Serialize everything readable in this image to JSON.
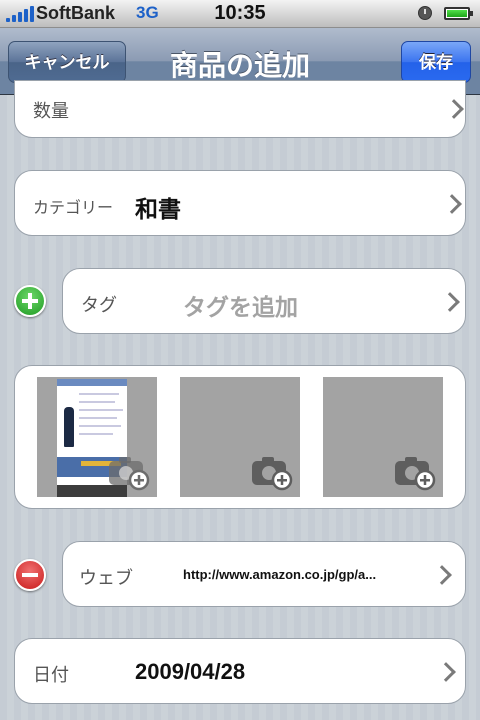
{
  "status_bar": {
    "carrier": "SoftBank",
    "network": "3G",
    "time": "10:35",
    "icons": [
      "signal-icon",
      "alarm-icon",
      "battery-icon"
    ]
  },
  "nav": {
    "title": "商品の追加",
    "cancel_label": "キャンセル",
    "save_label": "保存"
  },
  "form": {
    "quantity": {
      "label": "数量"
    },
    "category": {
      "label": "カテゴリー",
      "value": "和書"
    },
    "tag": {
      "label": "タグ",
      "placeholder": "タグを追加"
    },
    "photos": {
      "count_slots": 3
    },
    "web": {
      "label": "ウェブ",
      "value": "http://www.amazon.co.jp/gp/a..."
    },
    "date": {
      "label": "日付",
      "value": "2009/04/28"
    }
  },
  "colors": {
    "accent_save": "#2a6af0",
    "add_green": "#1e9a22",
    "remove_red": "#c81a1a",
    "nav_blue": "#6d84a2"
  }
}
